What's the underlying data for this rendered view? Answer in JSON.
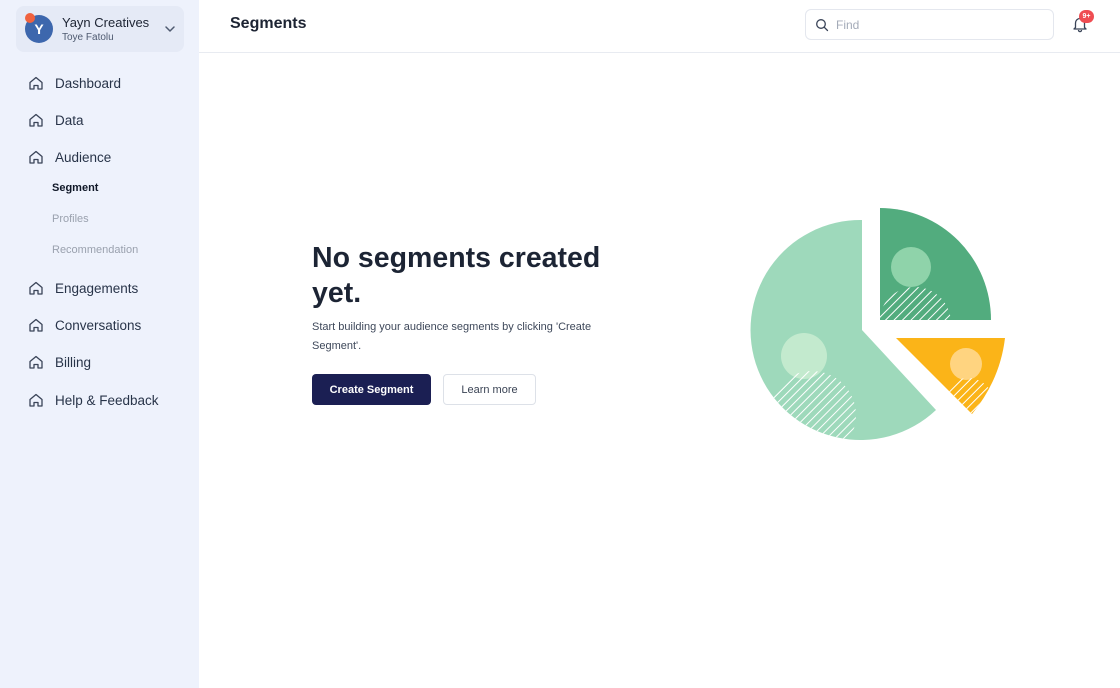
{
  "workspace": {
    "avatar_initial": "Y",
    "name": "Yayn Creatives",
    "user": "Toye Fatolu"
  },
  "sidebar": {
    "items": [
      {
        "label": "Dashboard"
      },
      {
        "label": "Data"
      },
      {
        "label": "Audience"
      },
      {
        "label": "Engagements"
      },
      {
        "label": "Conversations"
      },
      {
        "label": "Billing"
      },
      {
        "label": "Help & Feedback"
      }
    ],
    "audience_sub": [
      {
        "label": "Segment",
        "active": true
      },
      {
        "label": "Profiles",
        "active": false
      },
      {
        "label": "Recommendation",
        "active": false
      }
    ]
  },
  "header": {
    "title": "Segments",
    "search_placeholder": "Find",
    "search_value": "",
    "notification_badge": "9+"
  },
  "empty_state": {
    "headline": "No segments created yet.",
    "description": "Start building your audience segments by clicking 'Create Segment'.",
    "primary_button": "Create Segment",
    "secondary_button": "Learn more"
  },
  "colors": {
    "sidebar_bg": "#eef2fc",
    "primary_button": "#1b1f53",
    "avatar": "#3d67ad",
    "avatar_dot": "#f0623f",
    "badge": "#ef4d52",
    "illustration_light_green": "#9ed9bb",
    "illustration_dark_green": "#52ac7e",
    "illustration_yellow": "#fbb418"
  },
  "icons": {
    "workspace_toggle": "chevron-down-icon",
    "nav": "home-icon",
    "search": "search-icon",
    "notifications": "bell-icon"
  }
}
